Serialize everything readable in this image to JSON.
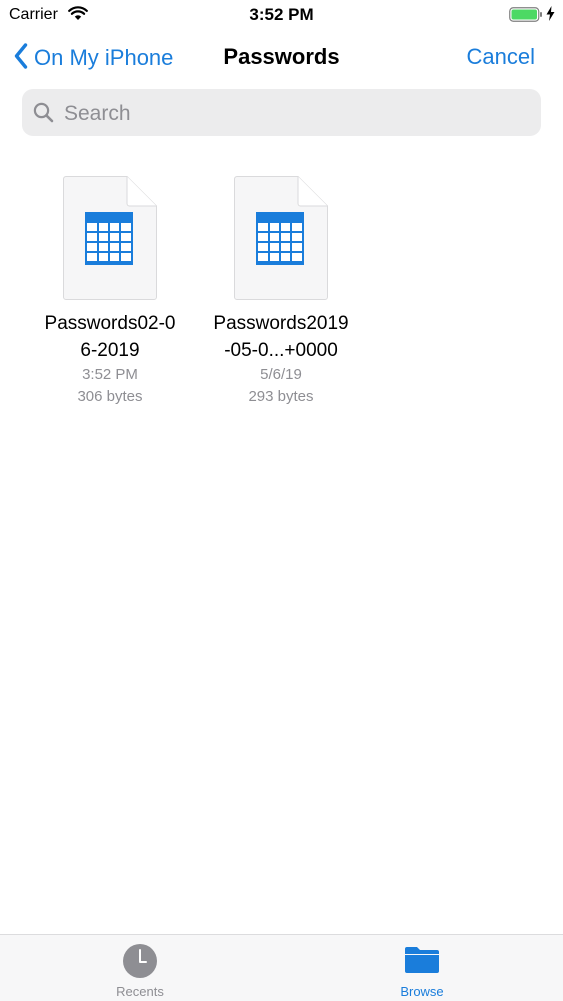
{
  "status_bar": {
    "carrier": "Carrier",
    "time": "3:52 PM"
  },
  "nav": {
    "back_label": "On My iPhone",
    "title": "Passwords",
    "cancel_label": "Cancel"
  },
  "search": {
    "placeholder": "Search"
  },
  "files": [
    {
      "name_line1": "Passwords02-0",
      "name_line2": "6-2019",
      "date": "3:52 PM",
      "size": "306 bytes",
      "icon": "spreadsheet-icon"
    },
    {
      "name_line1": "Passwords2019",
      "name_line2": "-05-0...+0000",
      "date": "5/6/19",
      "size": "293 bytes",
      "icon": "spreadsheet-icon"
    }
  ],
  "tabs": [
    {
      "label": "Recents",
      "icon": "clock-icon",
      "selected": false
    },
    {
      "label": "Browse",
      "icon": "folder-icon",
      "selected": true
    }
  ],
  "colors": {
    "accent": "#1a7ddb",
    "secondary_text": "#8e8e93",
    "tab_inactive": "#8e8e93",
    "battery": "#4cd964"
  }
}
